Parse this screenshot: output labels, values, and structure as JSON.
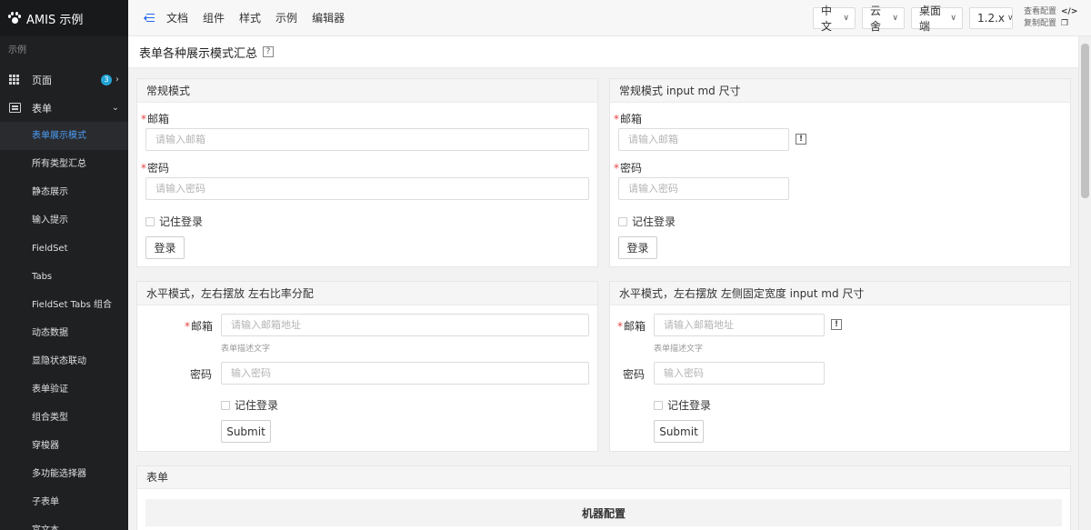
{
  "brand": {
    "title": "AMIS 示例"
  },
  "sidebar": {
    "section": "示例",
    "groups": [
      {
        "label": "页面",
        "badge": "3"
      },
      {
        "label": "表单"
      }
    ],
    "items": [
      {
        "label": "表单展示模式"
      },
      {
        "label": "所有类型汇总"
      },
      {
        "label": "静态展示"
      },
      {
        "label": "输入提示"
      },
      {
        "label": "FieldSet"
      },
      {
        "label": "Tabs"
      },
      {
        "label": "FieldSet Tabs 组合"
      },
      {
        "label": "动态数据"
      },
      {
        "label": "显隐状态联动"
      },
      {
        "label": "表单验证"
      },
      {
        "label": "组合类型"
      },
      {
        "label": "穿梭器"
      },
      {
        "label": "多功能选择器"
      },
      {
        "label": "子表单"
      },
      {
        "label": "富文本"
      }
    ]
  },
  "topbar": {
    "links": [
      "文档",
      "组件",
      "样式",
      "示例",
      "编辑器"
    ],
    "selects": [
      "中文",
      "云舍",
      "桌面端",
      "1.2.x"
    ],
    "view_config": "查看配置",
    "copy_config": "复制配置"
  },
  "page": {
    "title": "表单各种展示模式汇总"
  },
  "panel1": {
    "title": "常规模式",
    "email_label": "邮箱",
    "email_placeholder": "请输入邮箱",
    "password_label": "密码",
    "password_placeholder": "请输入密码",
    "remember": "记住登录",
    "submit": "登录"
  },
  "panel2": {
    "title": "常规模式 input md 尺寸",
    "email_label": "邮箱",
    "email_placeholder": "请输入邮箱",
    "password_label": "密码",
    "password_placeholder": "请输入密码",
    "remember": "记住登录",
    "submit": "登录"
  },
  "panel3": {
    "title": "水平模式，左右摆放 左右比率分配",
    "email_label": "邮箱",
    "email_placeholder": "请输入邮箱地址",
    "email_desc": "表单描述文字",
    "password_label": "密码",
    "password_placeholder": "输入密码",
    "remember": "记住登录",
    "submit": "Submit"
  },
  "panel4": {
    "title": "水平模式，左右摆放 左侧固定宽度 input md 尺寸",
    "email_label": "邮箱",
    "email_placeholder": "请输入邮箱地址",
    "email_desc": "表单描述文字",
    "password_label": "密码",
    "password_placeholder": "输入密码",
    "remember": "记住登录",
    "submit": "Submit"
  },
  "panel5": {
    "title": "表单",
    "table_title": "机器配置"
  },
  "icons": {
    "required_mark": "*",
    "warn_mark": "!",
    "help_mark": "?"
  }
}
